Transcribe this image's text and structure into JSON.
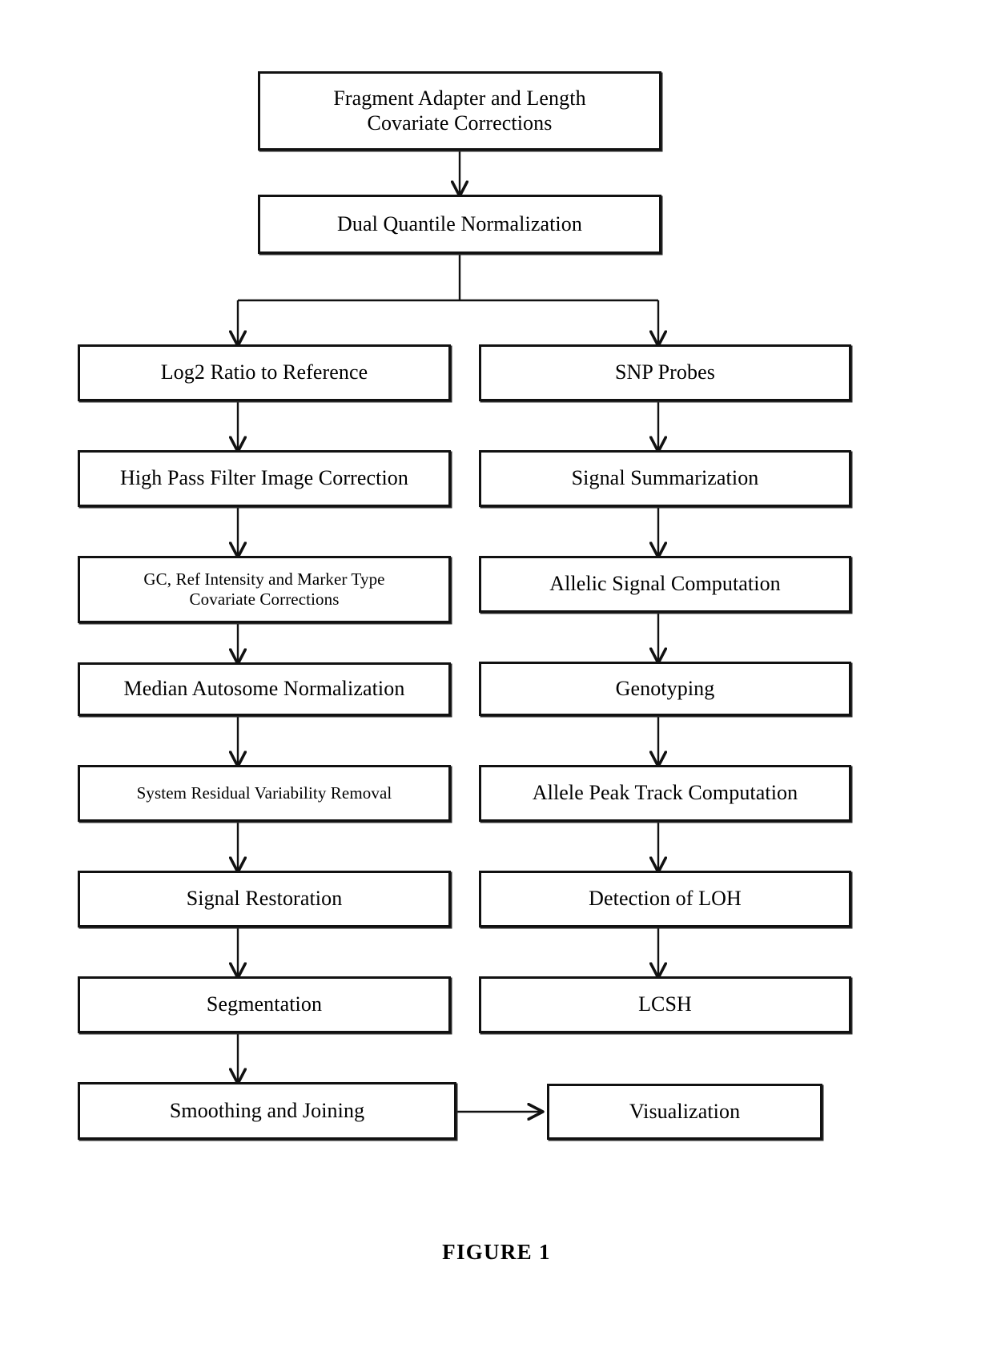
{
  "figure": {
    "caption": "FIGURE 1",
    "type": "flowchart",
    "orientation": "top-to-bottom"
  },
  "nodes": {
    "fragment_adapter": {
      "label": "Fragment Adapter and Length\nCovariate Corrections"
    },
    "dual_quantile": {
      "label": "Dual Quantile Normalization"
    },
    "log2_ratio": {
      "label": "Log2 Ratio to Reference"
    },
    "high_pass_filter": {
      "label": "High Pass Filter Image Correction"
    },
    "gc_ref_intensity": {
      "label": "GC, Ref Intensity and Marker Type\nCovariate Corrections"
    },
    "median_autosome": {
      "label": "Median Autosome Normalization"
    },
    "system_residual": {
      "label": "System Residual Variability Removal"
    },
    "signal_restoration": {
      "label": "Signal Restoration"
    },
    "segmentation": {
      "label": "Segmentation"
    },
    "smoothing_joining": {
      "label": "Smoothing and Joining"
    },
    "snp_probes": {
      "label": "SNP Probes"
    },
    "signal_summarization": {
      "label": "Signal Summarization"
    },
    "allelic_signal": {
      "label": "Allelic Signal Computation"
    },
    "genotyping": {
      "label": "Genotyping"
    },
    "allele_peak_track": {
      "label": "Allele Peak Track Computation"
    },
    "detection_loh": {
      "label": "Detection of LOH"
    },
    "lcsh": {
      "label": "LCSH"
    },
    "visualization": {
      "label": "Visualization"
    }
  },
  "colors": {
    "box_border": "#111111",
    "box_fill": "#ffffff",
    "connector": "#111111",
    "text": "#000000",
    "page_background": "#ffffff"
  },
  "flow_edges": [
    {
      "from": "fragment_adapter",
      "to": "dual_quantile",
      "style": "straight-down"
    },
    {
      "from": "dual_quantile",
      "to": "log2_ratio",
      "style": "branch-left"
    },
    {
      "from": "dual_quantile",
      "to": "snp_probes",
      "style": "branch-right"
    },
    {
      "from": "log2_ratio",
      "to": "high_pass_filter",
      "style": "straight-down"
    },
    {
      "from": "high_pass_filter",
      "to": "gc_ref_intensity",
      "style": "straight-down"
    },
    {
      "from": "gc_ref_intensity",
      "to": "median_autosome",
      "style": "straight-down"
    },
    {
      "from": "median_autosome",
      "to": "system_residual",
      "style": "straight-down"
    },
    {
      "from": "system_residual",
      "to": "signal_restoration",
      "style": "straight-down"
    },
    {
      "from": "signal_restoration",
      "to": "segmentation",
      "style": "straight-down"
    },
    {
      "from": "segmentation",
      "to": "smoothing_joining",
      "style": "straight-down"
    },
    {
      "from": "smoothing_joining",
      "to": "visualization",
      "style": "straight-right"
    },
    {
      "from": "snp_probes",
      "to": "signal_summarization",
      "style": "straight-down"
    },
    {
      "from": "signal_summarization",
      "to": "allelic_signal",
      "style": "straight-down"
    },
    {
      "from": "allelic_signal",
      "to": "genotyping",
      "style": "straight-down"
    },
    {
      "from": "genotyping",
      "to": "allele_peak_track",
      "style": "straight-down"
    },
    {
      "from": "allele_peak_track",
      "to": "detection_loh",
      "style": "straight-down"
    },
    {
      "from": "detection_loh",
      "to": "lcsh",
      "style": "straight-down"
    }
  ]
}
